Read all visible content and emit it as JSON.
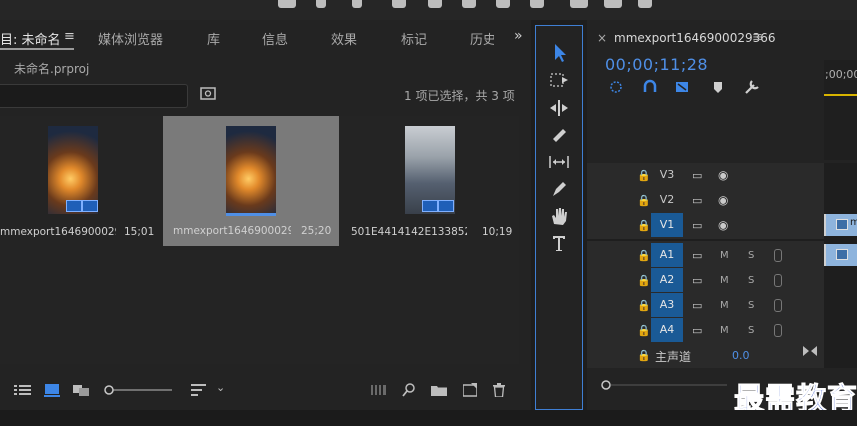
{
  "project": {
    "tabs": [
      "目: 未命名",
      "媒体浏览器",
      "库",
      "信息",
      "效果",
      "标记",
      "历史"
    ],
    "file_name": "未命名.prproj",
    "selection_status": "1 项已选择，共 3 项",
    "search_placeholder": "",
    "items": [
      {
        "name": "mmexport16469000290...",
        "duration": "15;01",
        "selected": false
      },
      {
        "name": "mmexport1646900029...",
        "duration": "25;20",
        "selected": true
      },
      {
        "name": "501E4414142E133852...",
        "duration": "10;19",
        "selected": false
      }
    ]
  },
  "timeline": {
    "sequence_name": "mmexport1646900029366",
    "timecode": "00;00;11;28",
    "ruler_time": ";00;00",
    "tracks": [
      {
        "name": "V3",
        "type": "video",
        "targeted": false
      },
      {
        "name": "V2",
        "type": "video",
        "targeted": false
      },
      {
        "name": "V1",
        "type": "video",
        "targeted": true
      },
      {
        "name": "A1",
        "type": "audio",
        "targeted": true
      },
      {
        "name": "A2",
        "type": "audio",
        "targeted": true
      },
      {
        "name": "A3",
        "type": "audio",
        "targeted": true
      },
      {
        "name": "A4",
        "type": "audio",
        "targeted": true
      }
    ],
    "mute_label": "M",
    "solo_label": "S",
    "master_label": "主声道",
    "master_value": "0.0",
    "clip_label": "m"
  },
  "watermark": "最需教育",
  "colors": {
    "accent": "#4f8fe6",
    "track_target": "#1a5a96",
    "clip": "#8eb4dd",
    "selection_card": "#7a7a7a"
  }
}
